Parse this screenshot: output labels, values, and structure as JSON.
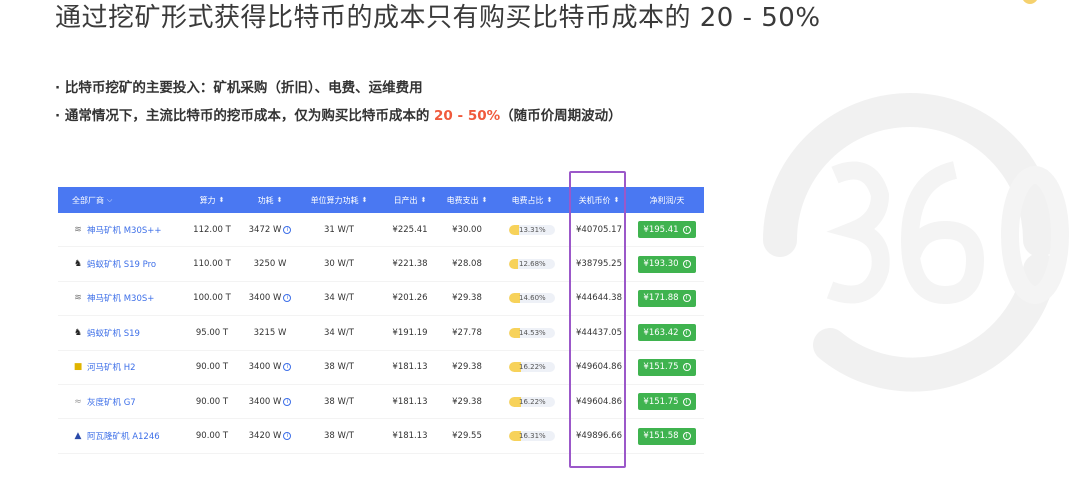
{
  "slide": {
    "title": "通过挖矿形式获得比特币的成本只有购买比特币成本的 20 - 50%"
  },
  "bullets": [
    {
      "prefix": "· 比特币挖矿的主要投入：矿机采购（折旧）、电费、运维费用",
      "highlight": "",
      "suffix": ""
    },
    {
      "prefix": "· 通常情况下，主流比特币的挖币成本，仅为购买比特币成本的 ",
      "highlight": "20 - 50%",
      "suffix": "（随币价周期波动）"
    }
  ],
  "table": {
    "headers": {
      "maker": "全部厂商",
      "hashrate": "算力",
      "power": "功耗",
      "efficiency": "单位算力功耗",
      "daily_output": "日产出",
      "electricity": "电费支出",
      "elec_ratio": "电费占比",
      "shutdown_price": "关机币价",
      "net_profit": "净利润/天"
    },
    "rows": [
      {
        "maker": "神马矿机 M30S++",
        "icon": "whatsminer-logo",
        "hashrate": "112.00 T",
        "power": "3472 W",
        "power_info": true,
        "efficiency": "31 W/T",
        "daily_output": "¥225.41",
        "electricity": "¥30.00",
        "elec_ratio": "13.31%",
        "elec_ratio_value": 0.1331,
        "shutdown_price": "¥40705.17",
        "net_profit": "¥195.41"
      },
      {
        "maker": "蚂蚁矿机 S19 Pro",
        "icon": "antminer-logo",
        "hashrate": "110.00 T",
        "power": "3250 W",
        "power_info": false,
        "efficiency": "30 W/T",
        "daily_output": "¥221.38",
        "electricity": "¥28.08",
        "elec_ratio": "12.68%",
        "elec_ratio_value": 0.1268,
        "shutdown_price": "¥38795.25",
        "net_profit": "¥193.30"
      },
      {
        "maker": "神马矿机 M30S+",
        "icon": "whatsminer-logo",
        "hashrate": "100.00 T",
        "power": "3400 W",
        "power_info": true,
        "efficiency": "34 W/T",
        "daily_output": "¥201.26",
        "electricity": "¥29.38",
        "elec_ratio": "14.60%",
        "elec_ratio_value": 0.146,
        "shutdown_price": "¥44644.38",
        "net_profit": "¥171.88"
      },
      {
        "maker": "蚂蚁矿机 S19",
        "icon": "antminer-logo",
        "hashrate": "95.00 T",
        "power": "3215 W",
        "power_info": false,
        "efficiency": "34 W/T",
        "daily_output": "¥191.19",
        "electricity": "¥27.78",
        "elec_ratio": "14.53%",
        "elec_ratio_value": 0.1453,
        "shutdown_price": "¥44437.05",
        "net_profit": "¥163.42"
      },
      {
        "maker": "河马矿机 H2",
        "icon": "hippo-logo",
        "hashrate": "90.00 T",
        "power": "3400 W",
        "power_info": true,
        "efficiency": "38 W/T",
        "daily_output": "¥181.13",
        "electricity": "¥29.38",
        "elec_ratio": "16.22%",
        "elec_ratio_value": 0.1622,
        "shutdown_price": "¥49604.86",
        "net_profit": "¥151.75"
      },
      {
        "maker": "灰度矿机 G7",
        "icon": "grey-logo",
        "hashrate": "90.00 T",
        "power": "3400 W",
        "power_info": true,
        "efficiency": "38 W/T",
        "daily_output": "¥181.13",
        "electricity": "¥29.38",
        "elec_ratio": "16.22%",
        "elec_ratio_value": 0.1622,
        "shutdown_price": "¥49604.86",
        "net_profit": "¥151.75"
      },
      {
        "maker": "阿瓦隆矿机 A1246",
        "icon": "avalon-logo",
        "hashrate": "90.00 T",
        "power": "3420 W",
        "power_info": true,
        "efficiency": "38 W/T",
        "daily_output": "¥181.13",
        "electricity": "¥29.55",
        "elec_ratio": "16.31%",
        "elec_ratio_value": 0.1631,
        "shutdown_price": "¥49896.66",
        "net_profit": "¥151.58"
      }
    ]
  },
  "colors": {
    "header_bg": "#4a78f2",
    "highlight": "#f05a3c",
    "profit_bg": "#3fb34f",
    "box_border": "#9b58c9",
    "ratio_fill": "#f7d25a"
  }
}
